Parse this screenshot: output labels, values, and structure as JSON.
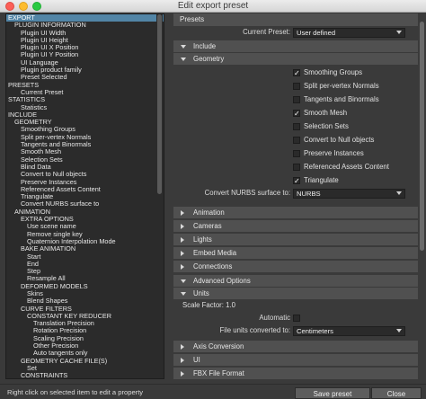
{
  "window": {
    "title": "Edit export preset"
  },
  "tree": {
    "items": [
      {
        "label": "EXPORT",
        "indent": 0,
        "selected": true
      },
      {
        "label": "PLUGIN INFORMATION",
        "indent": 1
      },
      {
        "label": "Plugin UI Width",
        "indent": 2
      },
      {
        "label": "Plugin UI Height",
        "indent": 2
      },
      {
        "label": "Plugin UI X Position",
        "indent": 2
      },
      {
        "label": "Plugin UI Y Position",
        "indent": 2
      },
      {
        "label": "UI Language",
        "indent": 2
      },
      {
        "label": "Plugin product family",
        "indent": 2
      },
      {
        "label": "Preset Selected",
        "indent": 2
      },
      {
        "label": "PRESETS",
        "indent": 0
      },
      {
        "label": "Current Preset",
        "indent": 2
      },
      {
        "label": "STATISTICS",
        "indent": 0
      },
      {
        "label": "Statistics",
        "indent": 2
      },
      {
        "label": "INCLUDE",
        "indent": 0
      },
      {
        "label": "GEOMETRY",
        "indent": 1
      },
      {
        "label": "Smoothing Groups",
        "indent": 2
      },
      {
        "label": "Split per-vertex Normals",
        "indent": 2
      },
      {
        "label": "Tangents and Binormals",
        "indent": 2
      },
      {
        "label": "Smooth Mesh",
        "indent": 2
      },
      {
        "label": "Selection Sets",
        "indent": 2
      },
      {
        "label": "Blind Data",
        "indent": 2
      },
      {
        "label": "Convert to Null objects",
        "indent": 2
      },
      {
        "label": "Preserve Instances",
        "indent": 2
      },
      {
        "label": "Referenced Assets Content",
        "indent": 2
      },
      {
        "label": "Triangulate",
        "indent": 2
      },
      {
        "label": "Convert NURBS surface to",
        "indent": 2
      },
      {
        "label": "ANIMATION",
        "indent": 1
      },
      {
        "label": "EXTRA OPTIONS",
        "indent": 2
      },
      {
        "label": "Use scene name",
        "indent": 3
      },
      {
        "label": "Remove single key",
        "indent": 3
      },
      {
        "label": "Quaternion Interpolation Mode",
        "indent": 3
      },
      {
        "label": "BAKE ANIMATION",
        "indent": 2
      },
      {
        "label": "Start",
        "indent": 3
      },
      {
        "label": "End",
        "indent": 3
      },
      {
        "label": "Step",
        "indent": 3
      },
      {
        "label": "Resample All",
        "indent": 3
      },
      {
        "label": "DEFORMED MODELS",
        "indent": 2
      },
      {
        "label": "Skins",
        "indent": 3
      },
      {
        "label": "Blend Shapes",
        "indent": 3
      },
      {
        "label": "CURVE FILTERS",
        "indent": 2
      },
      {
        "label": "CONSTANT KEY REDUCER",
        "indent": 3
      },
      {
        "label": "Translation Precision",
        "indent": 4
      },
      {
        "label": "Rotation Precision",
        "indent": 4
      },
      {
        "label": "Scaling Precision",
        "indent": 4
      },
      {
        "label": "Other Precision",
        "indent": 4
      },
      {
        "label": "Auto tangents only",
        "indent": 4
      },
      {
        "label": "GEOMETRY CACHE FILE(S)",
        "indent": 2
      },
      {
        "label": "Set",
        "indent": 3
      },
      {
        "label": "CONSTRAINTS",
        "indent": 2
      }
    ]
  },
  "panel": {
    "presets_header": "Presets",
    "current_preset_label": "Current Preset:",
    "current_preset_value": "User defined",
    "include_label": "Include",
    "geometry_label": "Geometry",
    "geometry_options": [
      {
        "label": "Smoothing Groups",
        "checked": true
      },
      {
        "label": "Split per-vertex Normals",
        "checked": false
      },
      {
        "label": "Tangents and Binormals",
        "checked": false
      },
      {
        "label": "Smooth Mesh",
        "checked": true
      },
      {
        "label": "Selection Sets",
        "checked": false
      },
      {
        "label": "Convert to Null objects",
        "checked": false
      },
      {
        "label": "Preserve Instances",
        "checked": false
      },
      {
        "label": "Referenced Assets Content",
        "checked": false
      },
      {
        "label": "Triangulate",
        "checked": true
      }
    ],
    "nurbs_label": "Convert NURBS surface to:",
    "nurbs_value": "NURBS",
    "animation_label": "Animation",
    "cameras_label": "Cameras",
    "lights_label": "Lights",
    "embed_media_label": "Embed Media",
    "connections_label": "Connections",
    "advanced_label": "Advanced Options",
    "units_label": "Units",
    "scale_factor": "Scale Factor: 1.0",
    "automatic_label": "Automatic",
    "file_units_label": "File units converted to:",
    "file_units_value": "Centimeters",
    "axis_conversion_label": "Axis Conversion",
    "ui_label": "UI",
    "fbx_format_label": "FBX File Format"
  },
  "status": {
    "hint": "Right click on selected item to edit a property",
    "save_label": "Save preset",
    "close_label": "Close"
  }
}
